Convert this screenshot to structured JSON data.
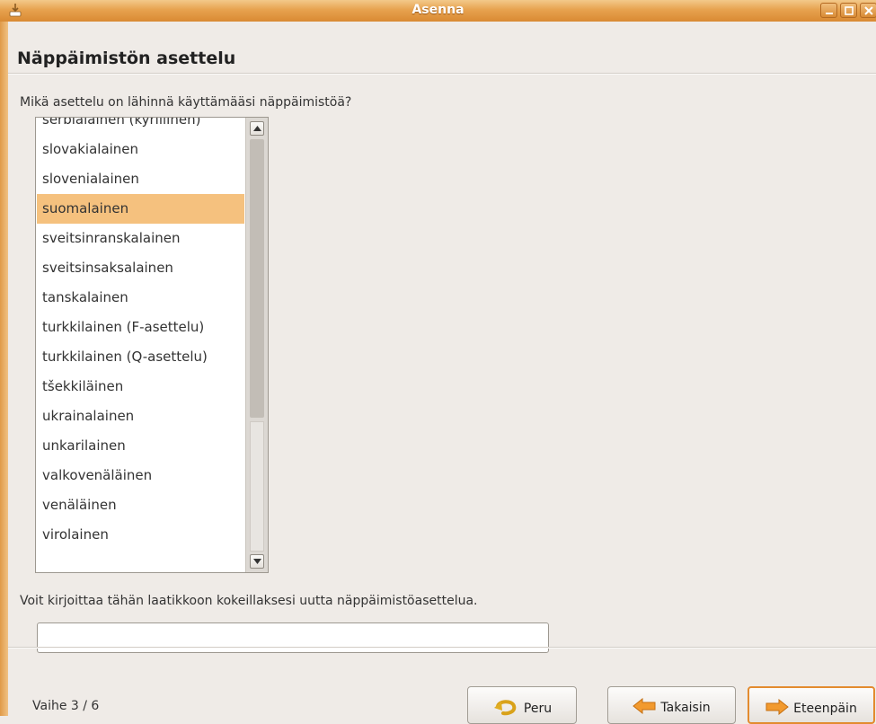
{
  "window": {
    "title": "Asenna"
  },
  "page": {
    "title": "Näppäimistön asettelu",
    "question": "Mikä asettelu on lähinnä käyttämääsi näppäimistöä?",
    "test_help": "Voit kirjoittaa tähän laatikkoon kokeillaksesi uutta näppäimistöasettelua.",
    "test_input": {
      "value": "",
      "placeholder": ""
    }
  },
  "layouts": {
    "selected": "suomalainen",
    "items": [
      "serbialainen (kyrillinen)",
      "slovakialainen",
      "slovenialainen",
      "suomalainen",
      "sveitsinranskalainen",
      "sveitsinsaksalainen",
      "tanskalainen",
      "turkkilainen (F-asettelu)",
      "turkkilainen (Q-asettelu)",
      "tšekkiläinen",
      "ukrainalainen",
      "unkarilainen",
      "valkovenäläinen",
      "venäläinen",
      "virolainen"
    ]
  },
  "footer": {
    "step": "Vaihe 3 / 6",
    "cancel_label": "Peru",
    "back_label": "Takaisin",
    "next_label": "Eteenpäin"
  },
  "colors": {
    "titlebar_accent": "#e7a24f",
    "selection": "#f5c17e",
    "default_button_border": "#e38b2f"
  },
  "icons": {
    "app": "installer-icon",
    "minimize": "minimize-icon",
    "maximize": "maximize-icon",
    "close": "close-icon",
    "cancel": "undo-arrow-icon",
    "back": "arrow-left-icon",
    "next": "arrow-right-icon"
  }
}
